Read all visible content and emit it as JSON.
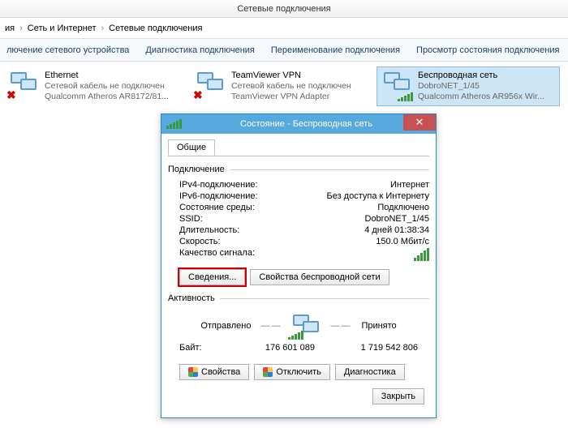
{
  "window_title": "Сетевые подключения",
  "breadcrumb": {
    "a": "ия",
    "b": "Сеть и Интернет",
    "c": "Сетевые подключения"
  },
  "toolbar": {
    "disable": "лючение сетевого устройства",
    "diagnose": "Диагностика подключения",
    "rename": "Переименование подключения",
    "viewstatus": "Просмотр состояния подключения"
  },
  "items": [
    {
      "name": "Ethernet",
      "status": "Сетевой кабель не подключен",
      "device": "Qualcomm Atheros AR8172/81...",
      "disconnected": true
    },
    {
      "name": "TeamViewer VPN",
      "status": "Сетевой кабель не подключен",
      "device": "TeamViewer VPN Adapter",
      "disconnected": true
    },
    {
      "name": "Беспроводная сеть",
      "status": "DobroNET_1/45",
      "device": "Qualcomm Atheros AR956x Wir...",
      "disconnected": false
    }
  ],
  "dialog": {
    "title": "Состояние - Беспроводная сеть",
    "tab_general": "Общие",
    "hdr_connection": "Подключение",
    "rows": {
      "ipv4_k": "IPv4-подключение:",
      "ipv4_v": "Интернет",
      "ipv6_k": "IPv6-подключение:",
      "ipv6_v": "Без доступа к Интернету",
      "media_k": "Состояние среды:",
      "media_v": "Подключено",
      "ssid_k": "SSID:",
      "ssid_v": "DobroNET_1/45",
      "dur_k": "Длительность:",
      "dur_v": "4 дней 01:38:34",
      "speed_k": "Скорость:",
      "speed_v": "150.0 Мбит/с",
      "sig_k": "Качество сигнала:"
    },
    "btn_details": "Сведения...",
    "btn_wprops": "Свойства беспроводной сети",
    "hdr_activity": "Активность",
    "sent": "Отправлено",
    "received": "Принято",
    "bytes_label": "Байт:",
    "bytes_sent": "176 601 089",
    "bytes_recv": "1 719 542 806",
    "btn_props": "Свойства",
    "btn_disable": "Отключить",
    "btn_diag": "Диагностика",
    "btn_close": "Закрыть"
  }
}
